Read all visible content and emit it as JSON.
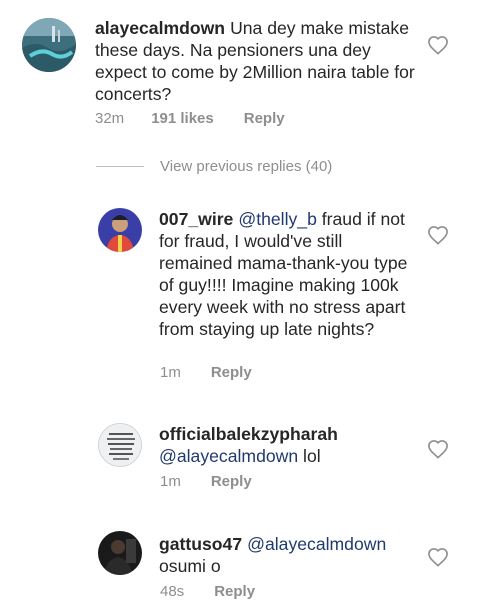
{
  "comments": [
    {
      "username": "alayecalmdown",
      "text": "Una dey make mistake these days. Na pensioners una dey expect to come by 2Million naira table for concerts?",
      "time": "32m",
      "likes": "191 likes",
      "reply": "Reply",
      "avatar_icon": "city-aerial-avatar"
    },
    {
      "username": "007_wire",
      "mention": "@thelly_b",
      "text": "fraud if not for fraud, I would've still remained mama-thank-you type of guy!!!! Imagine making 100k every week with no stress apart from staying up late nights?",
      "time": "1m",
      "reply": "Reply",
      "avatar_icon": "person-avatar"
    },
    {
      "username": "officialbalekzypharah",
      "mention": "@alayecalmdown",
      "text": "lol",
      "time": "1m",
      "reply": "Reply",
      "avatar_icon": "text-graphic-avatar"
    },
    {
      "username": "gattuso47",
      "mention": "@alayecalmdown",
      "text": "osumi o",
      "time": "48s",
      "reply": "Reply",
      "avatar_icon": "dark-person-avatar"
    }
  ],
  "view_previous": "View previous replies (40)",
  "colors": {
    "text": "#262626",
    "meta": "#8e8e8e",
    "mention": "#1f3a6e"
  }
}
